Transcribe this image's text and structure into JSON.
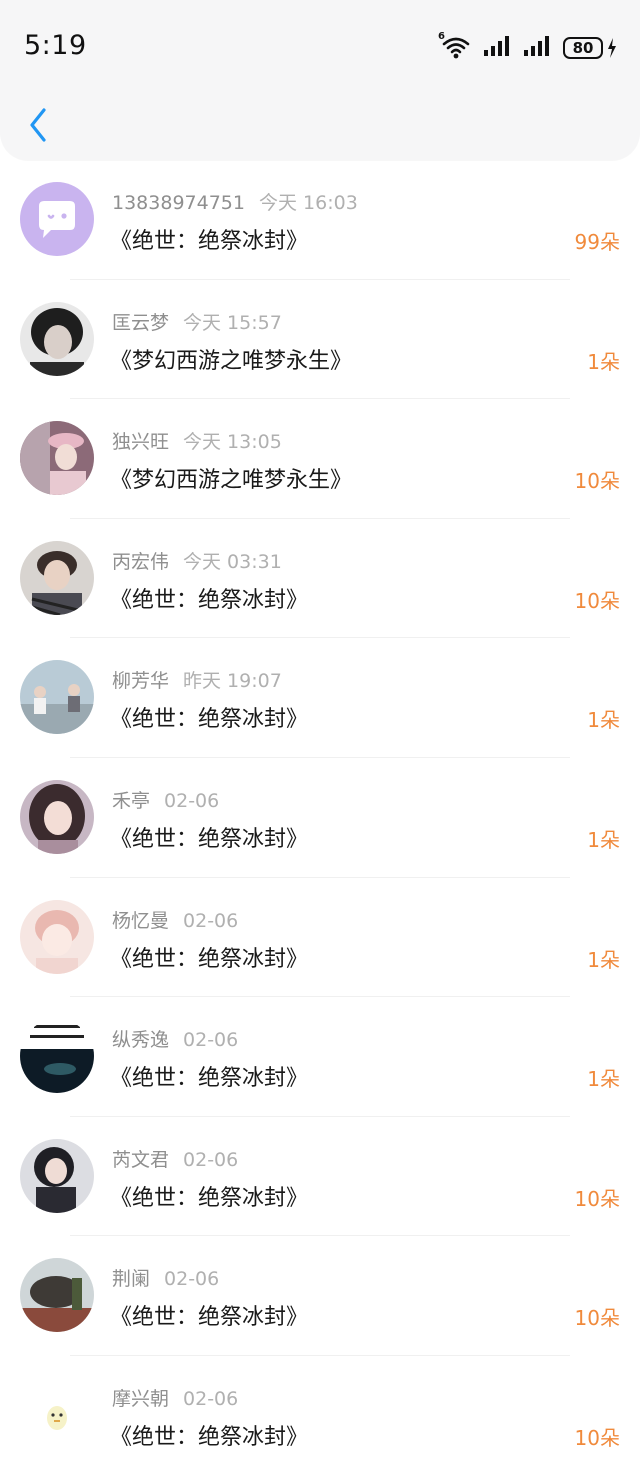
{
  "status_bar": {
    "time": "5:19",
    "wifi_badge": "6",
    "battery": "80"
  },
  "nav": {
    "back_icon": "chevron-left-icon"
  },
  "colors": {
    "accent": "#2196f3",
    "count": "#f08a3c"
  },
  "rows": [
    {
      "name": "13838974751",
      "date": "今天 16:03",
      "title": "《绝世：绝祭冰封》",
      "count": "99朵"
    },
    {
      "name": "匡云梦",
      "date": "今天 15:57",
      "title": "《梦幻西游之唯梦永生》",
      "count": "1朵"
    },
    {
      "name": "独兴旺",
      "date": "今天 13:05",
      "title": "《梦幻西游之唯梦永生》",
      "count": "10朵"
    },
    {
      "name": "丙宏伟",
      "date": "今天 03:31",
      "title": "《绝世：绝祭冰封》",
      "count": "10朵"
    },
    {
      "name": "柳芳华",
      "date": "昨天 19:07",
      "title": "《绝世：绝祭冰封》",
      "count": "1朵"
    },
    {
      "name": "禾亭",
      "date": "02-06",
      "title": "《绝世：绝祭冰封》",
      "count": "1朵"
    },
    {
      "name": "杨忆曼",
      "date": "02-06",
      "title": "《绝世：绝祭冰封》",
      "count": "1朵"
    },
    {
      "name": "纵秀逸",
      "date": "02-06",
      "title": "《绝世：绝祭冰封》",
      "count": "1朵"
    },
    {
      "name": "芮文君",
      "date": "02-06",
      "title": "《绝世：绝祭冰封》",
      "count": "10朵"
    },
    {
      "name": "荆阑",
      "date": "02-06",
      "title": "《绝世：绝祭冰封》",
      "count": "10朵"
    },
    {
      "name": "摩兴朝",
      "date": "02-06",
      "title": "《绝世：绝祭冰封》",
      "count": "10朵"
    }
  ]
}
